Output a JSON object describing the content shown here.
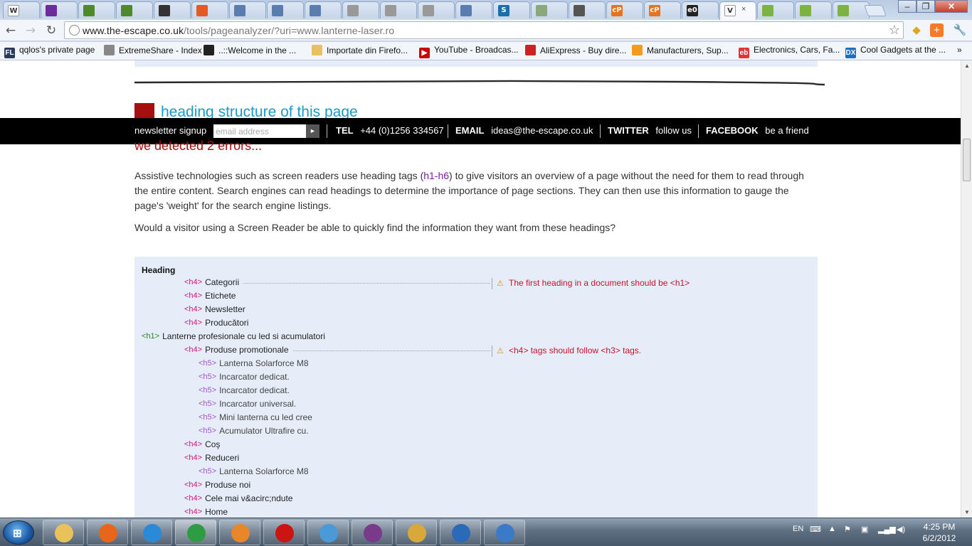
{
  "browser": {
    "tabs": [
      {
        "icon": "wikipedia-icon",
        "label": "W",
        "color": "#ffffff"
      },
      {
        "icon": "yahoo-mail-icon",
        "label": "",
        "color": "#6a2ba0"
      },
      {
        "icon": "wrench-tool-icon",
        "label": "",
        "color": "#4f8a2a"
      },
      {
        "icon": "wrench-tool-icon",
        "label": "",
        "color": "#4f8a2a"
      },
      {
        "icon": "site-icon",
        "label": "",
        "color": "#333333"
      },
      {
        "icon": "magento-icon",
        "label": "",
        "color": "#e55a24"
      },
      {
        "icon": "page-icon",
        "label": "",
        "color": "#5a7db0"
      },
      {
        "icon": "page-icon",
        "label": "",
        "color": "#5a7db0"
      },
      {
        "icon": "page-icon",
        "label": "",
        "color": "#5a7db0"
      },
      {
        "icon": "gray-globe-icon",
        "label": "",
        "color": "#999999"
      },
      {
        "icon": "gray-globe-icon",
        "label": "",
        "color": "#999999"
      },
      {
        "icon": "gray-globe-icon",
        "label": "",
        "color": "#999999"
      },
      {
        "icon": "document-icon",
        "label": "",
        "color": "#5a7db0"
      },
      {
        "icon": "s-logo-icon",
        "label": "S",
        "color": "#1d6ea8"
      },
      {
        "icon": "tile-icon",
        "label": "",
        "color": "#8aa87a"
      },
      {
        "icon": "star-icon",
        "label": "",
        "color": "#555555"
      },
      {
        "icon": "cpanel-icon",
        "label": "cP",
        "color": "#e8731c"
      },
      {
        "icon": "cpanel-icon",
        "label": "cP",
        "color": "#e8731c"
      },
      {
        "icon": "e0-icon",
        "label": "e0",
        "color": "#222222"
      },
      {
        "icon": "escape-icon",
        "label": "V",
        "color": "#ffffff"
      },
      {
        "icon": "android-icon",
        "label": "",
        "color": "#7cb342"
      },
      {
        "icon": "android-icon",
        "label": "",
        "color": "#7cb342"
      },
      {
        "icon": "android-icon",
        "label": "",
        "color": "#7cb342"
      }
    ],
    "active_tab_close": "×",
    "url_host": "www.the-escape.co.uk",
    "url_rest": "/tools/pageanalyzer/?uri=www.lanterne-laser.ro",
    "bookmarks": [
      {
        "label": "qqlos's private page",
        "icon": "fl-icon",
        "color": "#2a3b5c",
        "glyph": "FL"
      },
      {
        "label": "ExtremeShare - Index",
        "icon": "globe-icon",
        "color": "#888888",
        "glyph": ""
      },
      {
        "label": "..::Welcome in the ...",
        "icon": "cat-icon",
        "color": "#222222",
        "glyph": ""
      },
      {
        "label": "Importate din Firefo...",
        "icon": "folder-icon",
        "color": "#e8c061",
        "glyph": ""
      },
      {
        "label": "YouTube - Broadcas...",
        "icon": "youtube-icon",
        "color": "#cc0000",
        "glyph": "▶"
      },
      {
        "label": "AliExpress - Buy dire...",
        "icon": "aliexpress-icon",
        "color": "#cc2222",
        "glyph": ""
      },
      {
        "label": "Manufacturers, Sup...",
        "icon": "alibaba-icon",
        "color": "#f29b1c",
        "glyph": ""
      },
      {
        "label": "Electronics, Cars, Fa...",
        "icon": "ebay-icon",
        "color": "#e53238",
        "glyph": "eb"
      },
      {
        "label": "Cool Gadgets at the ...",
        "icon": "dx-icon",
        "color": "#1b6fc0",
        "glyph": "DX"
      }
    ]
  },
  "page": {
    "heading": "heading structure of this page",
    "errors_text": "we detected 2 errors...",
    "newsletter": {
      "label": "newsletter signup",
      "placeholder": "email address",
      "go": "►"
    },
    "contacts": [
      {
        "key": "TEL",
        "value": "+44 (0)1256 334567"
      },
      {
        "key": "EMAIL",
        "value": "ideas@the-escape.co.uk"
      },
      {
        "key": "TWITTER",
        "value": "follow us"
      },
      {
        "key": "FACEBOOK",
        "value": "be a friend"
      }
    ],
    "para1_a": "Assistive technologies such as screen readers use heading tags (",
    "para1_hl": "h1-h6",
    "para1_b": ") to give visitors an overview of a page without the need for them to read through the entire content. Search engines can read headings to determine the importance of page sections. They can then use this information to gauge the page's 'weight' for the search engine listings.",
    "para2": "Would a visitor using a Screen Reader be able to quickly find the information they want from these headings?",
    "outline_title": "Heading",
    "outline": [
      {
        "tag": "<h4>",
        "level": "h4",
        "text": "Categorii",
        "error": "The first heading in a document should be <h1>"
      },
      {
        "tag": "<h4>",
        "level": "h4",
        "text": "Etichete"
      },
      {
        "tag": "<h4>",
        "level": "h4",
        "text": "Newsletter"
      },
      {
        "tag": "<h4>",
        "level": "h4",
        "text": "Producători"
      },
      {
        "tag": "<h1>",
        "level": "h1",
        "text": "Lanterne profesionale cu led si acumulatori"
      },
      {
        "tag": "<h4>",
        "level": "h4",
        "text": "Produse promotionale",
        "error": "<h4> tags should follow <h3> tags."
      },
      {
        "tag": "<h5>",
        "level": "h5",
        "text": "Lanterna Solarforce M8"
      },
      {
        "tag": "<h5>",
        "level": "h5",
        "text": "Incarcator dedicat."
      },
      {
        "tag": "<h5>",
        "level": "h5",
        "text": "Incarcator dedicat."
      },
      {
        "tag": "<h5>",
        "level": "h5",
        "text": "Incarcator universal."
      },
      {
        "tag": "<h5>",
        "level": "h5",
        "text": "Mini lanterna cu led cree"
      },
      {
        "tag": "<h5>",
        "level": "h5",
        "text": "Acumulator Ultrafire cu."
      },
      {
        "tag": "<h4>",
        "level": "h4",
        "text": "Coş"
      },
      {
        "tag": "<h4>",
        "level": "h4",
        "text": "Reduceri"
      },
      {
        "tag": "<h5>",
        "level": "h5",
        "text": "Lanterna Solarforce M8"
      },
      {
        "tag": "<h4>",
        "level": "h4",
        "text": "Produse noi"
      },
      {
        "tag": "<h4>",
        "level": "h4",
        "text": "Cele mai v&acirc;ndute"
      },
      {
        "tag": "<h4>",
        "level": "h4",
        "text": "Home"
      }
    ]
  },
  "taskbar": {
    "apps": [
      {
        "icon": "explorer-folder-icon",
        "color": "#e9c25a"
      },
      {
        "icon": "firefox-icon",
        "color": "#e8661c"
      },
      {
        "icon": "internet-explorer-icon",
        "color": "#2a8ad8"
      },
      {
        "icon": "chrome-icon",
        "color": "#2e9c42"
      },
      {
        "icon": "media-player-icon",
        "color": "#e8862a"
      },
      {
        "icon": "opera-icon",
        "color": "#cc1414"
      },
      {
        "icon": "messenger-icon",
        "color": "#4a9ad8"
      },
      {
        "icon": "winrar-icon",
        "color": "#7a3a8a"
      },
      {
        "icon": "paint-icon",
        "color": "#d8a83a"
      },
      {
        "icon": "feather-icon",
        "color": "#2a6ab8"
      },
      {
        "icon": "picture-viewer-icon",
        "color": "#3a7ac8"
      }
    ],
    "language": "EN",
    "time": "4:25 PM",
    "date": "6/2/2012"
  }
}
